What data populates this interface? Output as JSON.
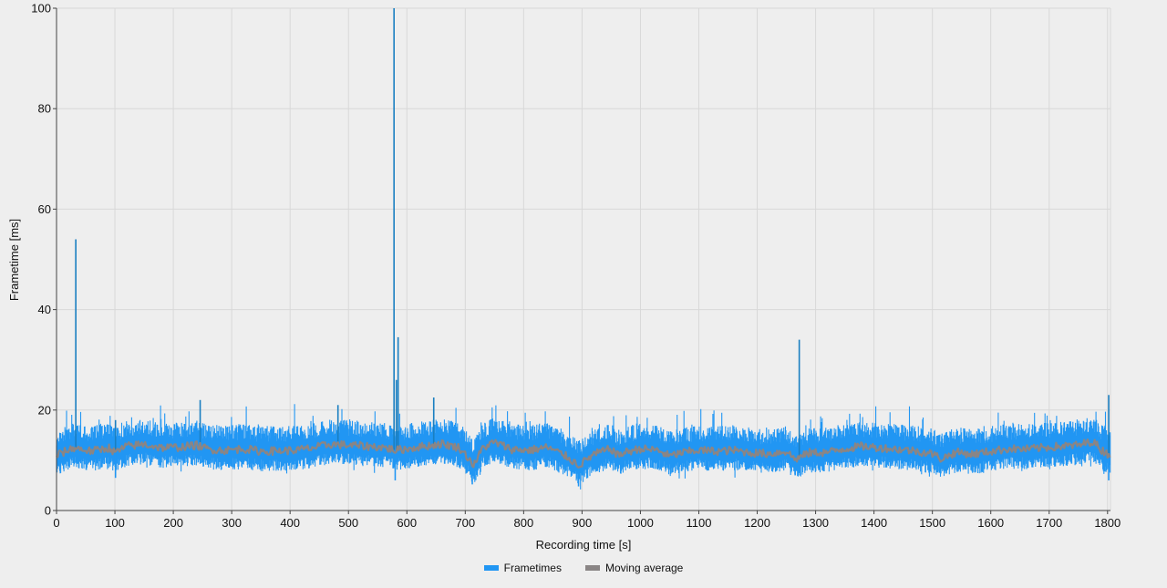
{
  "chart_data": {
    "type": "line",
    "title": "",
    "xlabel": "Recording time [s]",
    "ylabel": "Frametime [ms]",
    "xlim": [
      0,
      1805
    ],
    "ylim": [
      0,
      100
    ],
    "x_ticks": [
      0,
      100,
      200,
      300,
      400,
      500,
      600,
      700,
      800,
      900,
      1000,
      1100,
      1200,
      1300,
      1400,
      1500,
      1600,
      1700,
      1800
    ],
    "y_ticks": [
      0,
      20,
      40,
      60,
      80,
      100
    ],
    "grid": true,
    "legend_position": "bottom-center",
    "colors": {
      "frametimes": "#2196f3",
      "spikes": "#1a7fc1",
      "moving_average": "#8a8585",
      "grid": "#d8d8d8",
      "axis": "#444444"
    },
    "series": [
      {
        "name": "Frametimes",
        "baseline_ms": 12,
        "band_ms": [
          8.5,
          16.5
        ],
        "spikes": [
          {
            "x": 33,
            "y": 54
          },
          {
            "x": 101,
            "y": 18
          },
          {
            "x": 246,
            "y": 22
          },
          {
            "x": 482,
            "y": 21
          },
          {
            "x": 578,
            "y": 100
          },
          {
            "x": 582,
            "y": 26
          },
          {
            "x": 585,
            "y": 34.5
          },
          {
            "x": 646,
            "y": 22.5
          },
          {
            "x": 1272,
            "y": 34
          },
          {
            "x": 1802,
            "y": 23
          }
        ],
        "dips": [
          {
            "x": 101,
            "y": 6.5
          },
          {
            "x": 580,
            "y": 6
          },
          {
            "x": 712,
            "y": 5.2
          },
          {
            "x": 894,
            "y": 4.8
          },
          {
            "x": 1265,
            "y": 7
          },
          {
            "x": 1512,
            "y": 7.5
          },
          {
            "x": 1802,
            "y": 6
          }
        ]
      },
      {
        "name": "Moving average",
        "points": [
          [
            0,
            11
          ],
          [
            30,
            12.5
          ],
          [
            60,
            11.8
          ],
          [
            90,
            12.5
          ],
          [
            100,
            11.5
          ],
          [
            120,
            12.8
          ],
          [
            150,
            13.2
          ],
          [
            180,
            12.5
          ],
          [
            210,
            12.6
          ],
          [
            240,
            13.0
          ],
          [
            260,
            12.2
          ],
          [
            290,
            12.0
          ],
          [
            320,
            12.3
          ],
          [
            350,
            11.8
          ],
          [
            380,
            11.9
          ],
          [
            410,
            12.0
          ],
          [
            440,
            12.5
          ],
          [
            470,
            13.2
          ],
          [
            500,
            13.0
          ],
          [
            530,
            12.8
          ],
          [
            560,
            12.6
          ],
          [
            580,
            12.0
          ],
          [
            600,
            12.3
          ],
          [
            630,
            12.8
          ],
          [
            660,
            13.3
          ],
          [
            690,
            12.5
          ],
          [
            705,
            10.5
          ],
          [
            715,
            9.0
          ],
          [
            730,
            12.5
          ],
          [
            750,
            13.6
          ],
          [
            780,
            12.2
          ],
          [
            810,
            12.0
          ],
          [
            840,
            12.6
          ],
          [
            870,
            11.0
          ],
          [
            895,
            9.0
          ],
          [
            920,
            11.2
          ],
          [
            950,
            12.3
          ],
          [
            960,
            11.0
          ],
          [
            980,
            11.8
          ],
          [
            1000,
            12.3
          ],
          [
            1030,
            12.0
          ],
          [
            1050,
            10.8
          ],
          [
            1070,
            11.5
          ],
          [
            1100,
            12.0
          ],
          [
            1130,
            11.8
          ],
          [
            1160,
            12.0
          ],
          [
            1190,
            11.5
          ],
          [
            1220,
            11.3
          ],
          [
            1250,
            11.8
          ],
          [
            1265,
            10.2
          ],
          [
            1290,
            11.5
          ],
          [
            1320,
            11.6
          ],
          [
            1350,
            12.3
          ],
          [
            1380,
            12.8
          ],
          [
            1410,
            12.5
          ],
          [
            1440,
            12.2
          ],
          [
            1470,
            11.9
          ],
          [
            1500,
            11.3
          ],
          [
            1515,
            10.3
          ],
          [
            1540,
            11.6
          ],
          [
            1570,
            11.2
          ],
          [
            1600,
            11.8
          ],
          [
            1630,
            12.3
          ],
          [
            1660,
            12.2
          ],
          [
            1690,
            12.5
          ],
          [
            1720,
            12.8
          ],
          [
            1750,
            13.0
          ],
          [
            1775,
            13.8
          ],
          [
            1790,
            12.0
          ],
          [
            1805,
            11.0
          ]
        ]
      }
    ]
  }
}
